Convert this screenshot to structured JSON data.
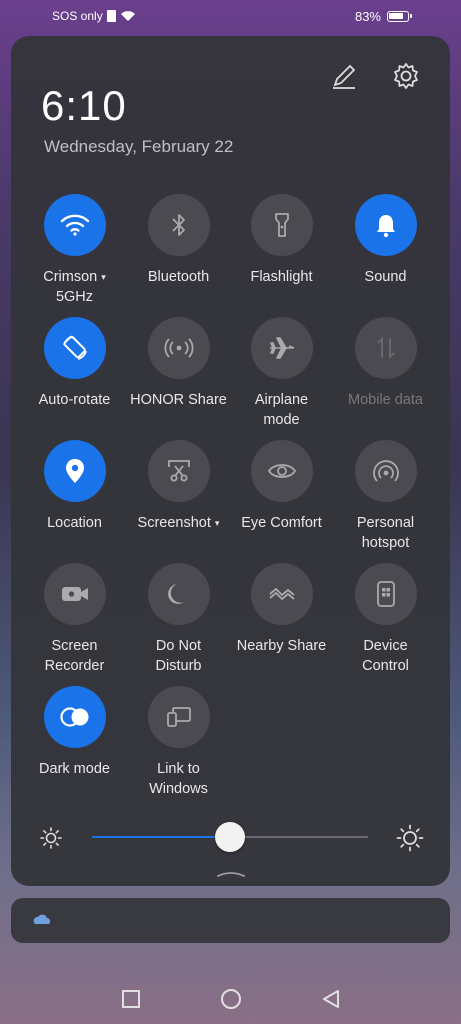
{
  "status_bar": {
    "carrier": "SOS only",
    "battery_percent": "83%"
  },
  "header": {
    "time": "6:10",
    "date": "Wednesday, February 22"
  },
  "tiles": [
    {
      "line1": "Crimson",
      "line2": "5GHz",
      "icon": "wifi-icon",
      "on": true,
      "caret": "▾"
    },
    {
      "line1": "Bluetooth",
      "line2": "",
      "icon": "bluetooth-icon",
      "on": false
    },
    {
      "line1": "Flashlight",
      "line2": "",
      "icon": "flashlight-icon",
      "on": false
    },
    {
      "line1": "Sound",
      "line2": "",
      "icon": "bell-icon",
      "on": true
    },
    {
      "line1": "Auto-rotate",
      "line2": "",
      "icon": "auto-rotate-icon",
      "on": true
    },
    {
      "line1": "HONOR Share",
      "line2": "",
      "icon": "honor-share-icon",
      "on": false
    },
    {
      "line1": "Airplane",
      "line2": "mode",
      "icon": "airplane-icon",
      "on": false
    },
    {
      "line1": "Mobile data",
      "line2": "",
      "icon": "mobile-data-icon",
      "on": false,
      "disabled": true
    },
    {
      "line1": "Location",
      "line2": "",
      "icon": "location-icon",
      "on": true
    },
    {
      "line1": "Screenshot",
      "line2": "",
      "icon": "screenshot-icon",
      "on": false,
      "caret": "▾"
    },
    {
      "line1": "Eye Comfort",
      "line2": "",
      "icon": "eye-icon",
      "on": false
    },
    {
      "line1": "Personal",
      "line2": "hotspot",
      "icon": "hotspot-icon",
      "on": false
    },
    {
      "line1": "Screen",
      "line2": "Recorder",
      "icon": "screen-recorder-icon",
      "on": false
    },
    {
      "line1": "Do Not",
      "line2": "Disturb",
      "icon": "moon-icon",
      "on": false
    },
    {
      "line1": "Nearby Share",
      "line2": "",
      "icon": "nearby-share-icon",
      "on": false
    },
    {
      "line1": "Device",
      "line2": "Control",
      "icon": "device-control-icon",
      "on": false
    },
    {
      "line1": "Dark mode",
      "line2": "",
      "icon": "dark-mode-icon",
      "on": true
    },
    {
      "line1": "Link to",
      "line2": "Windows",
      "icon": "link-to-windows-icon",
      "on": false
    }
  ],
  "brightness": {
    "level": 0.5
  },
  "colors": {
    "accent": "#1a73e8",
    "tile_off": "#4a4a50",
    "panel": "#34343a"
  }
}
